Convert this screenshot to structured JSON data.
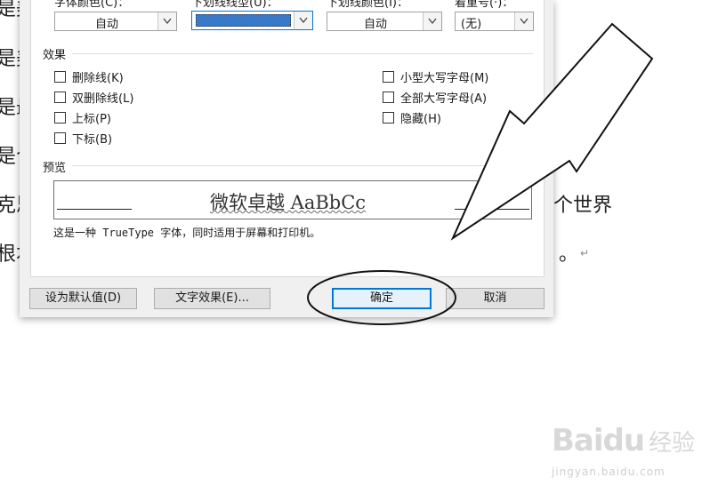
{
  "document": {
    "left_fragments": [
      "是美",
      "是最",
      "是合",
      "克思",
      "根本"
    ],
    "right_fragments": [
      "个世界",
      "。"
    ]
  },
  "dialog": {
    "top_labels": [
      "字体颜色(C)：",
      "下划线线型(U)：",
      "下划线颜色(I)：",
      "着重号(·)："
    ],
    "font_color": "自动",
    "underline_color": "自动",
    "emphasis": "(无)",
    "effects_title": "效果",
    "effects_left": [
      "删除线(K)",
      "双删除线(L)",
      "上标(P)",
      "下标(B)"
    ],
    "effects_right": [
      "小型大写字母(M)",
      "全部大写字母(A)",
      "隐藏(H)"
    ],
    "preview_title": "预览",
    "preview_sample": "微软卓越  AaBbCc",
    "note": "这是一种 TrueType 字体，同时适用于屏幕和打印机。",
    "buttons": {
      "set_default": "设为默认值(D)",
      "text_effects": "文字效果(E)...",
      "ok": "确定",
      "cancel": "取消"
    }
  },
  "watermark": {
    "logo": "Bai",
    "du": "du",
    "brand": "经验",
    "url": "jingyan.baidu.com"
  },
  "colors": {
    "accent": "#0078d7",
    "dialog_bg": "#f0f0f0"
  }
}
